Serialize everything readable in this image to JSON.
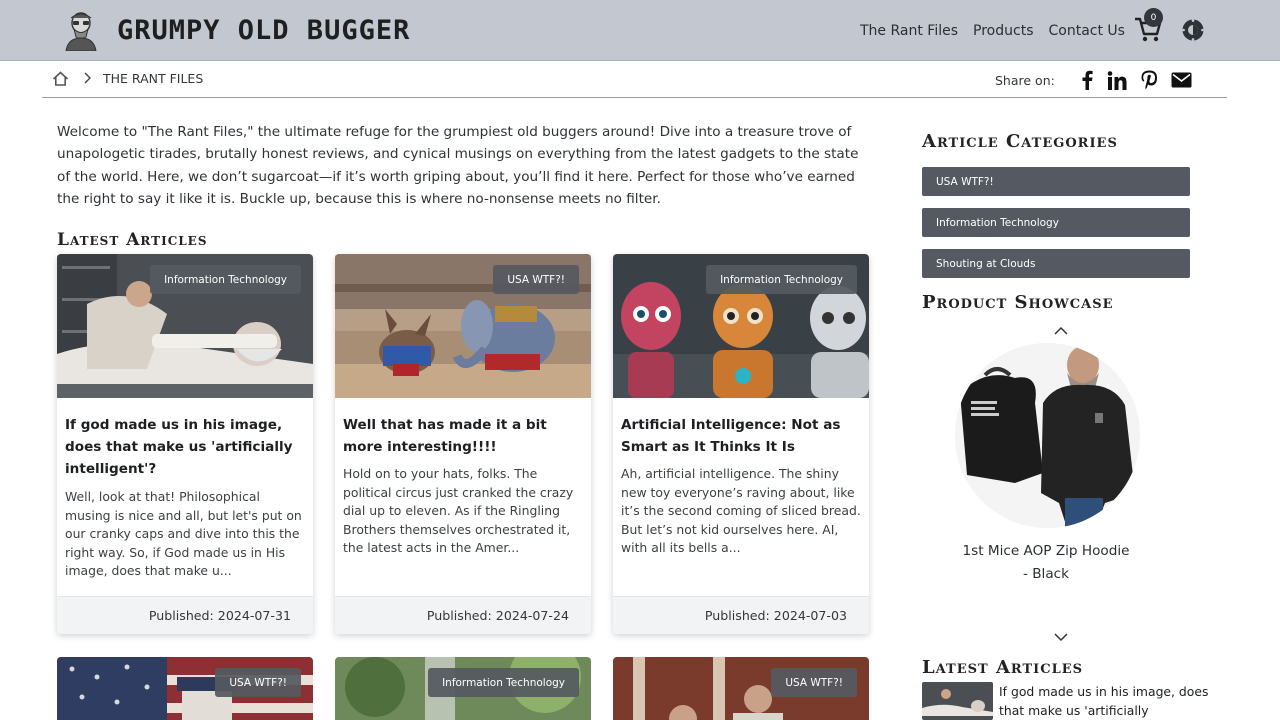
{
  "header": {
    "brand": "GRUMPY OLD BUGGER",
    "nav": [
      "The Rant Files",
      "Products",
      "Contact Us"
    ],
    "cart_count": "0"
  },
  "breadcrumb": {
    "current": "THE RANT FILES"
  },
  "share": {
    "label": "Share on:",
    "networks": [
      "facebook-icon",
      "linkedin-icon",
      "pinterest-icon",
      "email-icon"
    ]
  },
  "intro": "Welcome to \"The Rant Files,\" the ultimate refuge for the grumpiest old buggers around! Dive into a treasure trove of unapologetic tirades, brutally honest reviews, and cynical musings on everything from the latest gadgets to the state of the world. Here, we don’t sugarcoat—if it’s worth griping about, you’ll find it here. Perfect for those who’ve earned the right to say it like it is. Buckle up, because this is where no-nonsense meets no filter.",
  "latest_title": "Latest Articles",
  "articles": [
    {
      "category": "Information Technology",
      "title": "If god made us in his image, does that make us 'artificially intelligent'?",
      "excerpt": "Well, look at that! Philosophical musing is nice and all, but let's put on our cranky caps and dive into this the right way. So, if God made us in His image, does that make u...",
      "published": "Published: 2024-07-31"
    },
    {
      "category": "USA WTF?!",
      "title": "Well that has made it a bit more interesting!!!!",
      "excerpt": "Hold on to your hats, folks. The political circus just cranked the crazy dial up to eleven. As if the Ringling Brothers themselves orchestrated it, the latest acts in the Amer...",
      "published": "Published: 2024-07-24"
    },
    {
      "category": "Information Technology",
      "title": "Artificial Intelligence: Not as Smart as It Thinks It Is",
      "excerpt": "Ah, artificial intelligence. The shiny new toy everyone’s raving about, like it’s the second coming of sliced bread. But let’s not kid ourselves here. AI, with all its bells a...",
      "published": "Published: 2024-07-03"
    }
  ],
  "articles_row2": [
    {
      "category": "USA WTF?!"
    },
    {
      "category": "Information Technology"
    },
    {
      "category": "USA WTF?!"
    }
  ],
  "sidebar": {
    "categories_title": "Article Categories",
    "categories": [
      "USA WTF?!",
      "Information Technology",
      "Shouting at Clouds"
    ],
    "showcase_title": "Product Showcase",
    "product_name": "1st Mice AOP Zip Hoodie - Black",
    "latest_title": "Latest Articles",
    "latest_first": "If god made us in his image, does that make us 'artificially"
  }
}
